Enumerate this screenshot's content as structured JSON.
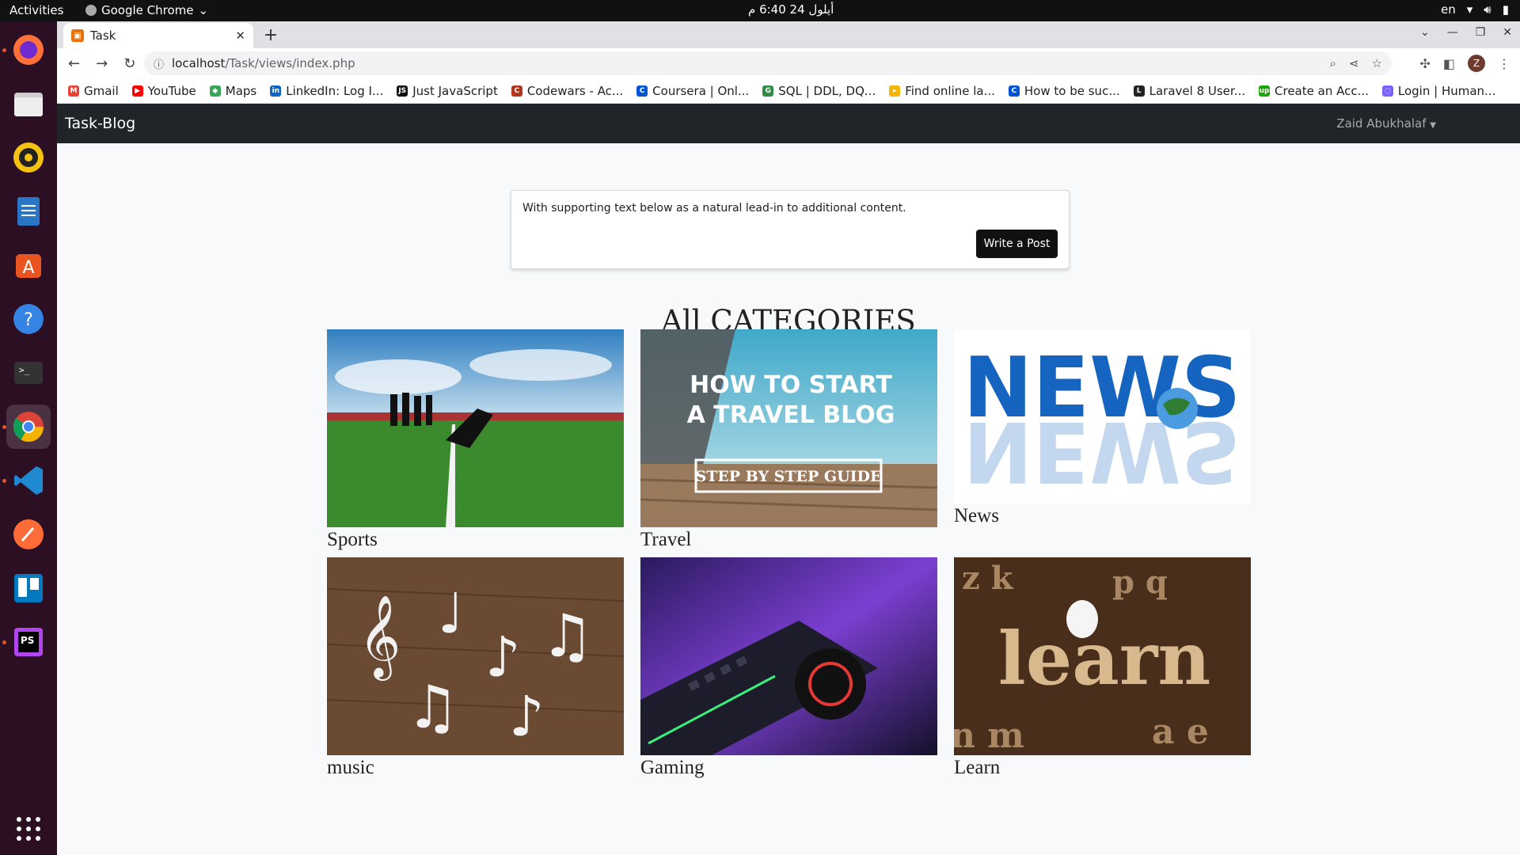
{
  "system_bar": {
    "activities": "Activities",
    "app_name": "Google Chrome",
    "clock": "أيلول 24  6:40 م",
    "lang": "en"
  },
  "browser": {
    "tab_title": "Task",
    "url_host": "localhost",
    "url_path": "/Task/views/index.php",
    "profile_initial": "Z",
    "bookmarks": [
      {
        "label": "Gmail",
        "color": "#ea4335",
        "glyph": "M"
      },
      {
        "label": "YouTube",
        "color": "#ff0000",
        "glyph": "▶"
      },
      {
        "label": "Maps",
        "color": "#34a853",
        "glyph": "◆"
      },
      {
        "label": "LinkedIn: Log I...",
        "color": "#0a66c2",
        "glyph": "in"
      },
      {
        "label": "Just JavaScript",
        "color": "#111111",
        "glyph": "JS"
      },
      {
        "label": "Codewars - Ac...",
        "color": "#b1361e",
        "glyph": "C"
      },
      {
        "label": "Coursera | Onl...",
        "color": "#0056d2",
        "glyph": "C"
      },
      {
        "label": "SQL | DDL, DQ...",
        "color": "#2f8d46",
        "glyph": "G"
      },
      {
        "label": "Find online la...",
        "color": "#f4b400",
        "glyph": "▸"
      },
      {
        "label": "How to be suc...",
        "color": "#0056d2",
        "glyph": "C"
      },
      {
        "label": "Laravel 8 User...",
        "color": "#222222",
        "glyph": "L"
      },
      {
        "label": "Create an Acc...",
        "color": "#14a800",
        "glyph": "up"
      },
      {
        "label": "Login | Human...",
        "color": "#7b61ff",
        "glyph": "◌"
      }
    ]
  },
  "page": {
    "brand": "Task-Blog",
    "user_name": "Zaid Abukhalaf",
    "card_text": "With supporting text below as a natural lead-in to additional content.",
    "write_button": "Write a Post",
    "heading": "All CATEGORIES",
    "categories": [
      {
        "label": "Sports"
      },
      {
        "label": "Travel"
      },
      {
        "label": "News"
      },
      {
        "label": "music"
      },
      {
        "label": "Gaming"
      },
      {
        "label": "Learn"
      }
    ],
    "travel_banner_line1": "HOW TO START",
    "travel_banner_line2": "A TRAVEL BLOG",
    "travel_banner_line3": "STEP BY STEP GUIDE",
    "news_word": "NEWS",
    "learn_word": "learn"
  }
}
